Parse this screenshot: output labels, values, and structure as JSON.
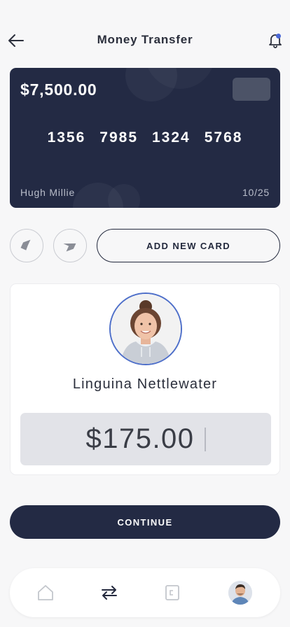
{
  "header": {
    "title": "Money Transfer",
    "back_icon": "arrow-left-icon",
    "notification_icon": "bell-icon",
    "notification_dot_color": "#4a67d6"
  },
  "card": {
    "balance": "$7,500.00",
    "number_groups": [
      "1356",
      "7985",
      "1324",
      "5768"
    ],
    "holder": "Hugh Millie",
    "expiry": "10/25",
    "background_color": "#232a44"
  },
  "card_actions": {
    "prev_icon": "card-left-icon",
    "next_icon": "card-right-icon",
    "add_card_label": "ADD NEW CARD"
  },
  "recipient": {
    "name": "Linguina Nettlewater",
    "amount": "$175.00",
    "ring_color": "#4e6fc9"
  },
  "continue_label": "CONTINUE",
  "nav": {
    "items": [
      "home-icon",
      "transfer-icon",
      "wallet-icon",
      "profile-avatar"
    ],
    "active": "transfer-icon"
  }
}
